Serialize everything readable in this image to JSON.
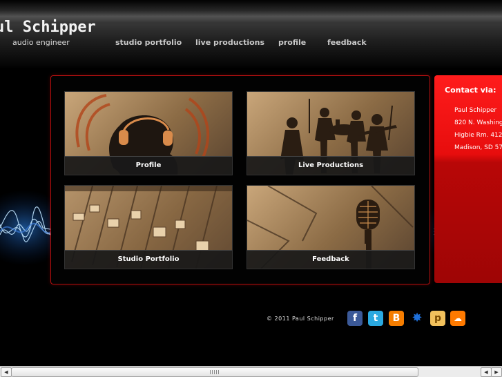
{
  "header": {
    "logo_name": "ul Schipper",
    "logo_subtitle": "audio engineer"
  },
  "nav": {
    "items": [
      {
        "label": "studio portfolio"
      },
      {
        "label": "live productions"
      },
      {
        "label": "profile"
      },
      {
        "label": "feedback"
      }
    ]
  },
  "tiles": [
    {
      "caption": "Profile"
    },
    {
      "caption": "Live Productions"
    },
    {
      "caption": "Studio Portfolio"
    },
    {
      "caption": "Feedback"
    }
  ],
  "contact": {
    "title": "Contact via:",
    "lines": [
      "Paul Schipper",
      "820 N. Washing",
      "Higbie Rm. 412",
      "Madison, SD 57"
    ]
  },
  "footer": {
    "copyright": "© 2011 Paul Schipper",
    "social_icons": [
      "facebook-icon",
      "twitter-icon",
      "blogger-icon",
      "myspace-icon",
      "pandora-icon",
      "soundcloud-icon"
    ]
  },
  "colors": {
    "accent_red": "#e70d0d",
    "panel_border": "#b51010",
    "wave_blue": "#4fb6ff"
  }
}
